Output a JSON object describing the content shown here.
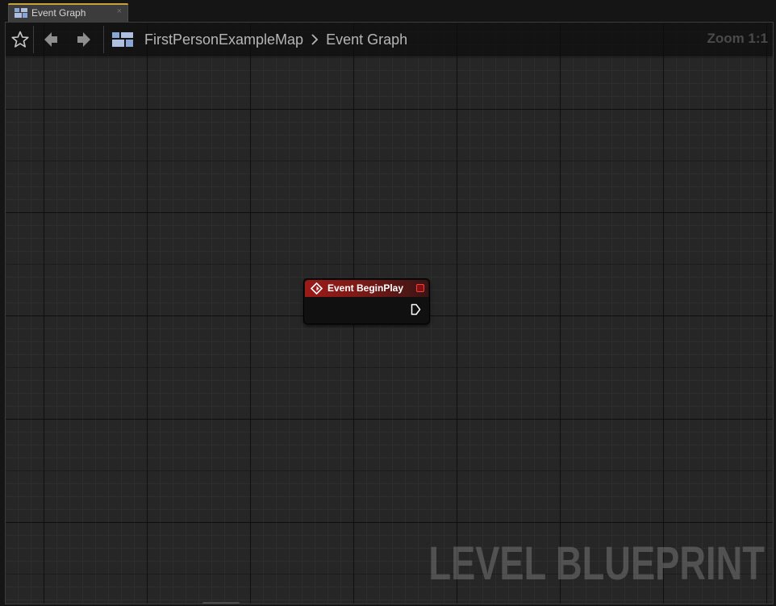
{
  "tab": {
    "label": "Event Graph",
    "close_glyph": "×",
    "icon": "blueprint-graph-icon",
    "accent_color": "#c9a33a"
  },
  "toolbar": {
    "favorite_icon": "star-icon",
    "back_icon": "arrow-left-icon",
    "forward_icon": "arrow-right-icon",
    "breadcrumb": {
      "icon": "blueprint-graph-icon",
      "level": "FirstPersonExampleMap",
      "graph": "Event Graph"
    },
    "zoom_label": "Zoom 1:1"
  },
  "graph": {
    "watermark": "LEVEL BLUEPRINT",
    "background_color": "#262626"
  },
  "node": {
    "title": "Event BeginPlay",
    "icon": "event-diamond-icon",
    "header_color": "#9c1a18",
    "delegate_pin_color": "#ff3b3b",
    "exec_pin_icon": "exec-output-pin-icon"
  }
}
